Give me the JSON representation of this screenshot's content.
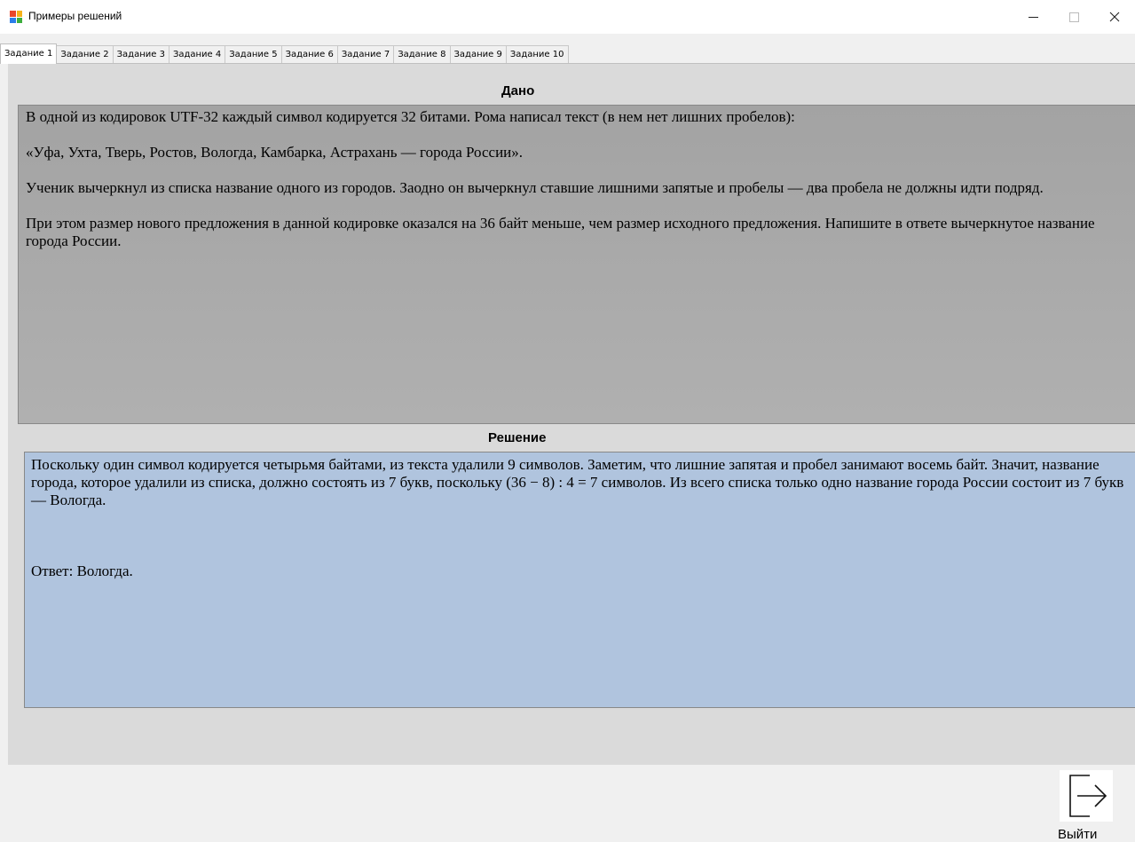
{
  "window": {
    "title": "Примеры решений",
    "controls": {
      "minimize": "–",
      "maximize": "□",
      "close": "✕"
    }
  },
  "tabs": [
    {
      "label": "Задание 1",
      "active": true
    },
    {
      "label": "Задание 2",
      "active": false
    },
    {
      "label": "Задание 3",
      "active": false
    },
    {
      "label": "Задание 4",
      "active": false
    },
    {
      "label": "Задание 5",
      "active": false
    },
    {
      "label": "Задание 6",
      "active": false
    },
    {
      "label": "Задание 7",
      "active": false
    },
    {
      "label": "Задание 8",
      "active": false
    },
    {
      "label": "Задание 9",
      "active": false
    },
    {
      "label": "Задание 10",
      "active": false
    }
  ],
  "given": {
    "label": "Дано",
    "paragraphs": [
      "В одной из кодировок UTF-32 каждый символ кодируется 32 битами. Рома написал текст (в нем нет лишних пробелов):",
      "«Уфа, Ухта, Тверь, Ростов, Вологда, Камбарка, Астрахань — города России».",
      "Ученик вычеркнул из списка название одного из городов. Заодно он вычеркнул ставшие лишними запятые и пробелы — два пробела не должны идти подряд.",
      "При этом размер нового предложения в данной кодировке оказался на 36 байт меньше, чем размер исходного предложения. Напишите в ответе вычеркнутое название города России."
    ]
  },
  "solution": {
    "label": "Решение",
    "text": "Поскольку один символ кодируется четырьмя байтами, из текста удалили 9 символов. Заметим, что лишние запятая и пробел занимают восемь байт. Значит, название города, которое удалили из списка, должно состоять из 7 букв, поскольку (36 − 8) : 4 = 7 символов. Из всего списка только одно название города России состоит из 7 букв — Вологда.",
    "answer": "Ответ: Вологда."
  },
  "exit_button": {
    "label": "Выйти",
    "icon": "exit-arrow-icon"
  },
  "colors": {
    "given_bg": "#a9a9a9",
    "solution_bg": "#b0c4de",
    "panel_bg": "#dadada"
  }
}
